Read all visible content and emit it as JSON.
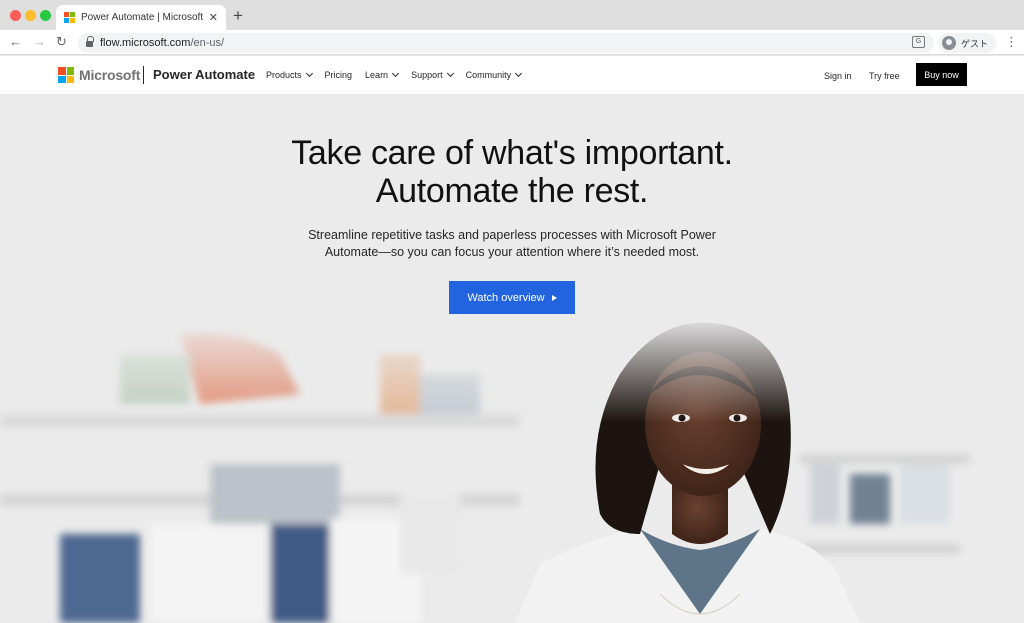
{
  "browser": {
    "tab_title": "Power Automate | Microsoft Po",
    "tab_close": "✕",
    "new_tab": "+",
    "url_host": "flow.microsoft.com",
    "url_path": "/en-us/",
    "profile_name": "ゲスト",
    "back": "←",
    "forward": "→",
    "reload": "↻",
    "menu": "⋮"
  },
  "header": {
    "brand": "Microsoft",
    "product": "Power Automate",
    "nav": [
      {
        "label": "Products",
        "dropdown": true
      },
      {
        "label": "Pricing",
        "dropdown": false
      },
      {
        "label": "Learn",
        "dropdown": true
      },
      {
        "label": "Support",
        "dropdown": true
      },
      {
        "label": "Community",
        "dropdown": true
      }
    ],
    "sign_in": "Sign in",
    "try_free": "Try free",
    "buy_now": "Buy now"
  },
  "hero": {
    "title_line1": "Take care of what's important.",
    "title_line2": "Automate the rest.",
    "subtitle_line1": "Streamline repetitive tasks and paperless processes with Microsoft Power",
    "subtitle_line2": "Automate—so you can focus your attention where it’s needed most.",
    "cta_label": "Watch overview"
  },
  "colors": {
    "accent": "#2264e0",
    "ms_red": "#f25022",
    "ms_green": "#7fba00",
    "ms_blue": "#00a4ef",
    "ms_yellow": "#ffb900"
  }
}
